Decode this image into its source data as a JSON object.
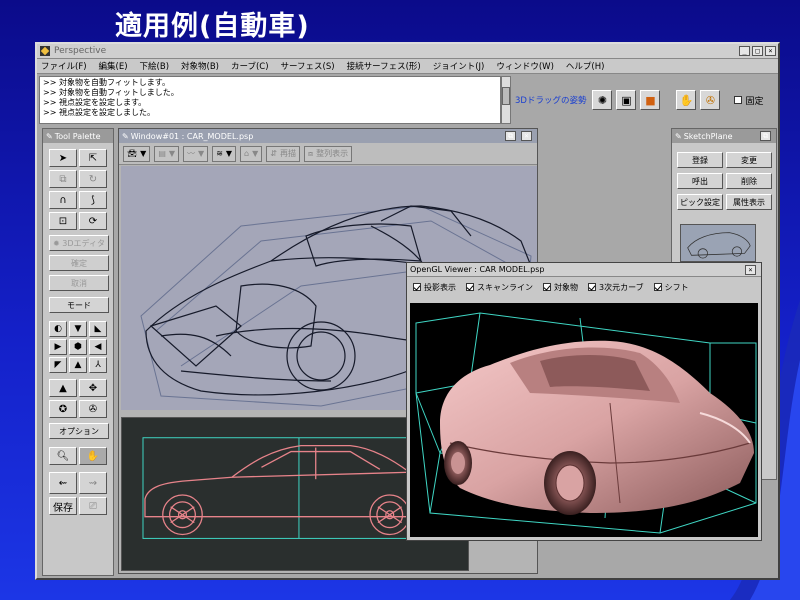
{
  "slide": {
    "title": "適用例(自動車)"
  },
  "app": {
    "title": "Perspective",
    "menu": [
      "ファイル(F)",
      "編集(E)",
      "下絵(B)",
      "対象物(B)",
      "カーブ(C)",
      "サーフェス(S)",
      "接続サーフェス(形)",
      "ジョイント(J)",
      "ウィンドウ(W)",
      "ヘルプ(H)"
    ],
    "messages": [
      ">> 対象物を自動フィットします。",
      ">> 対象物を自動フィットしました。",
      ">> 視点設定を設定します。",
      ">> 視点設定を設定しました。"
    ],
    "drag_label": "3Dドラッグの姿勢",
    "fix_label": "固定"
  },
  "tool_palette": {
    "title": "Tool Palette",
    "btn_3d_edit": "3Dエディタ",
    "btn_confirm": "確定",
    "btn_cancel": "取消",
    "btn_mode": "モード",
    "btn_option": "オプション",
    "btn_save": "保存"
  },
  "window1": {
    "title": "Window#01 : CAR_MODEL.psp",
    "btn_redraw": "再描",
    "btn_arrange": "整列表示"
  },
  "sketch_plane": {
    "title": "SketchPlane",
    "btns": [
      "登録",
      "変更",
      "呼出",
      "削除",
      "ピック設定",
      "属性表示"
    ]
  },
  "gl_viewer": {
    "title": "OpenGL Viewer : CAR MODEL.psp",
    "checks": [
      "投影表示",
      "スキャンライン",
      "対象物",
      "3次元カーブ",
      "シフト"
    ]
  },
  "colors": {
    "bg_top": "#0b0b8a",
    "bg_bottom": "#1c36e6",
    "shaded_car": "#d9a3a3",
    "wire": "#3fd6c4",
    "ortho_lines": "#e7838a"
  }
}
